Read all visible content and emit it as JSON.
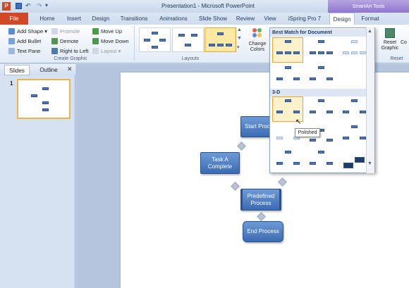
{
  "title": "Presentation1 - Microsoft PowerPoint",
  "context_tab": "SmartArt Tools",
  "tabs": [
    "File",
    "Home",
    "Insert",
    "Design",
    "Transitions",
    "Animations",
    "Slide Show",
    "Review",
    "View",
    "iSpring Pro 7",
    "Design",
    "Format"
  ],
  "ribbon": {
    "create_graphic": [
      "Add Shape",
      "Add Bullet",
      "Text Pane",
      "Promote",
      "Demote",
      "Right to Left",
      "Move Up",
      "Move Down",
      "Layout"
    ],
    "group_create": "Create Graphic",
    "group_layouts": "Layouts",
    "change_colors": "Change Colors",
    "reset_graphic": "Reset Graphic",
    "convert_short": "Co",
    "group_reset": "Reset"
  },
  "pane_tabs": [
    "Slides",
    "Outline"
  ],
  "slide_number": "1",
  "shapes": [
    "Start Proce",
    "Task A Complete",
    "Predefined Process",
    "End Process"
  ],
  "gallery": {
    "best_match": "Best Match for Document",
    "three_d": "3-D",
    "tooltip": "Polished"
  },
  "colors": {
    "file_tab": "#d24726",
    "accent": "#3c6bb2",
    "context": "#8d73cf"
  }
}
